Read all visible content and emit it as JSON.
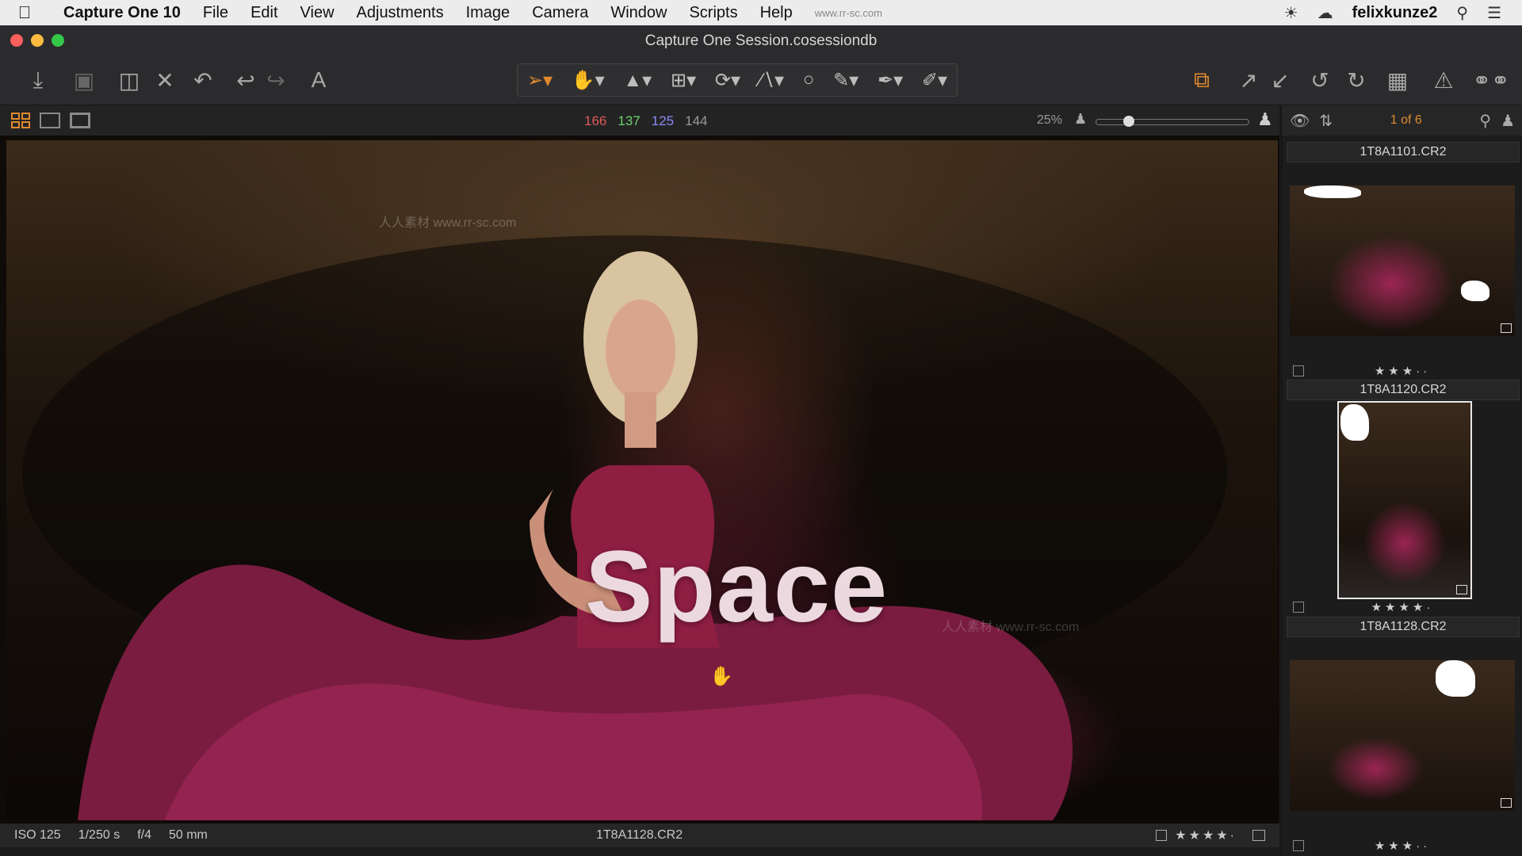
{
  "menubar": {
    "items": [
      "Capture One 10",
      "File",
      "Edit",
      "View",
      "Adjustments",
      "Image",
      "Camera",
      "Window",
      "Scripts",
      "Help"
    ],
    "watermark": "www.rr-sc.com",
    "user": "felixkunze2"
  },
  "window": {
    "title": "Capture One Session.cosessiondb"
  },
  "toolbar": {
    "left_icons": [
      "import-icon",
      "camera-icon",
      "move-folder-icon",
      "delete-icon",
      "undo-all-icon",
      "undo-icon",
      "redo-icon",
      "text-icon"
    ],
    "cursor_tools": [
      "select-tool-icon",
      "pan-tool-icon",
      "loupe-tool-icon",
      "crop-tool-icon",
      "rotate-tool-icon",
      "keystone-tool-icon",
      "spot-tool-icon",
      "brush-tool-icon",
      "eraser-tool-icon",
      "picker-tool-icon"
    ],
    "right_icons": [
      "copy-adjustments-icon",
      "apply-icon",
      "pick-icon",
      "rotate-left-icon",
      "rotate-right-icon",
      "grid-icon",
      "warning-icon",
      "proof-glasses-icon"
    ]
  },
  "viewerbar": {
    "rgb": {
      "r": "166",
      "g": "137",
      "b": "125",
      "l": "144"
    },
    "zoom": "25%"
  },
  "viewer": {
    "overlay_text": "Space",
    "watermark": "人人素材 www.rr-sc.com"
  },
  "status": {
    "iso": "ISO 125",
    "shutter": "1/250 s",
    "aperture": "f/4",
    "focal": "50 mm",
    "filename": "1T8A1128.CR2",
    "rating": 4
  },
  "browser": {
    "counter": "1 of 6",
    "items": [
      {
        "label": "1T8A1101.CR2",
        "rating": 3
      },
      {
        "label": "1T8A1120.CR2",
        "rating": 4
      },
      {
        "label": "1T8A1128.CR2",
        "rating": 3
      }
    ]
  },
  "colors": {
    "accent": "#e08a2e",
    "red": "#e05a5a",
    "green": "#6fd06f",
    "blue": "#7c7cf0",
    "dress": "#8a2048"
  }
}
